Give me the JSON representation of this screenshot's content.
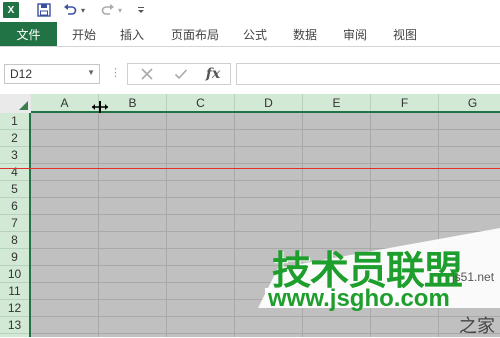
{
  "qat": {
    "app_icon": "excel-icon",
    "save_icon": "save-icon",
    "undo_icon": "undo-icon",
    "redo_icon": "redo-icon"
  },
  "ribbon": {
    "file": "文件",
    "tabs": [
      "开始",
      "插入",
      "页面布局",
      "公式",
      "数据",
      "审阅",
      "视图"
    ]
  },
  "formula_bar": {
    "name_box": "D12",
    "cancel_icon": "cancel-icon",
    "enter_icon": "enter-icon",
    "fx": "fx",
    "value": ""
  },
  "sheet": {
    "columns": [
      "A",
      "B",
      "C",
      "D",
      "E",
      "F",
      "G"
    ],
    "rows": [
      "1",
      "2",
      "3",
      "4",
      "5",
      "6",
      "7",
      "8",
      "9",
      "10",
      "11",
      "12",
      "13"
    ],
    "colors": {
      "header_bg": "#d2e9d6",
      "accent": "#217346",
      "cell_bg": "#c0c0c0",
      "row_marker": "#e0302a"
    }
  },
  "watermark": {
    "title": "技术员联盟",
    "url": "www.jsgho.com",
    "domain_fragment": "js51.net",
    "tail": "之家"
  }
}
